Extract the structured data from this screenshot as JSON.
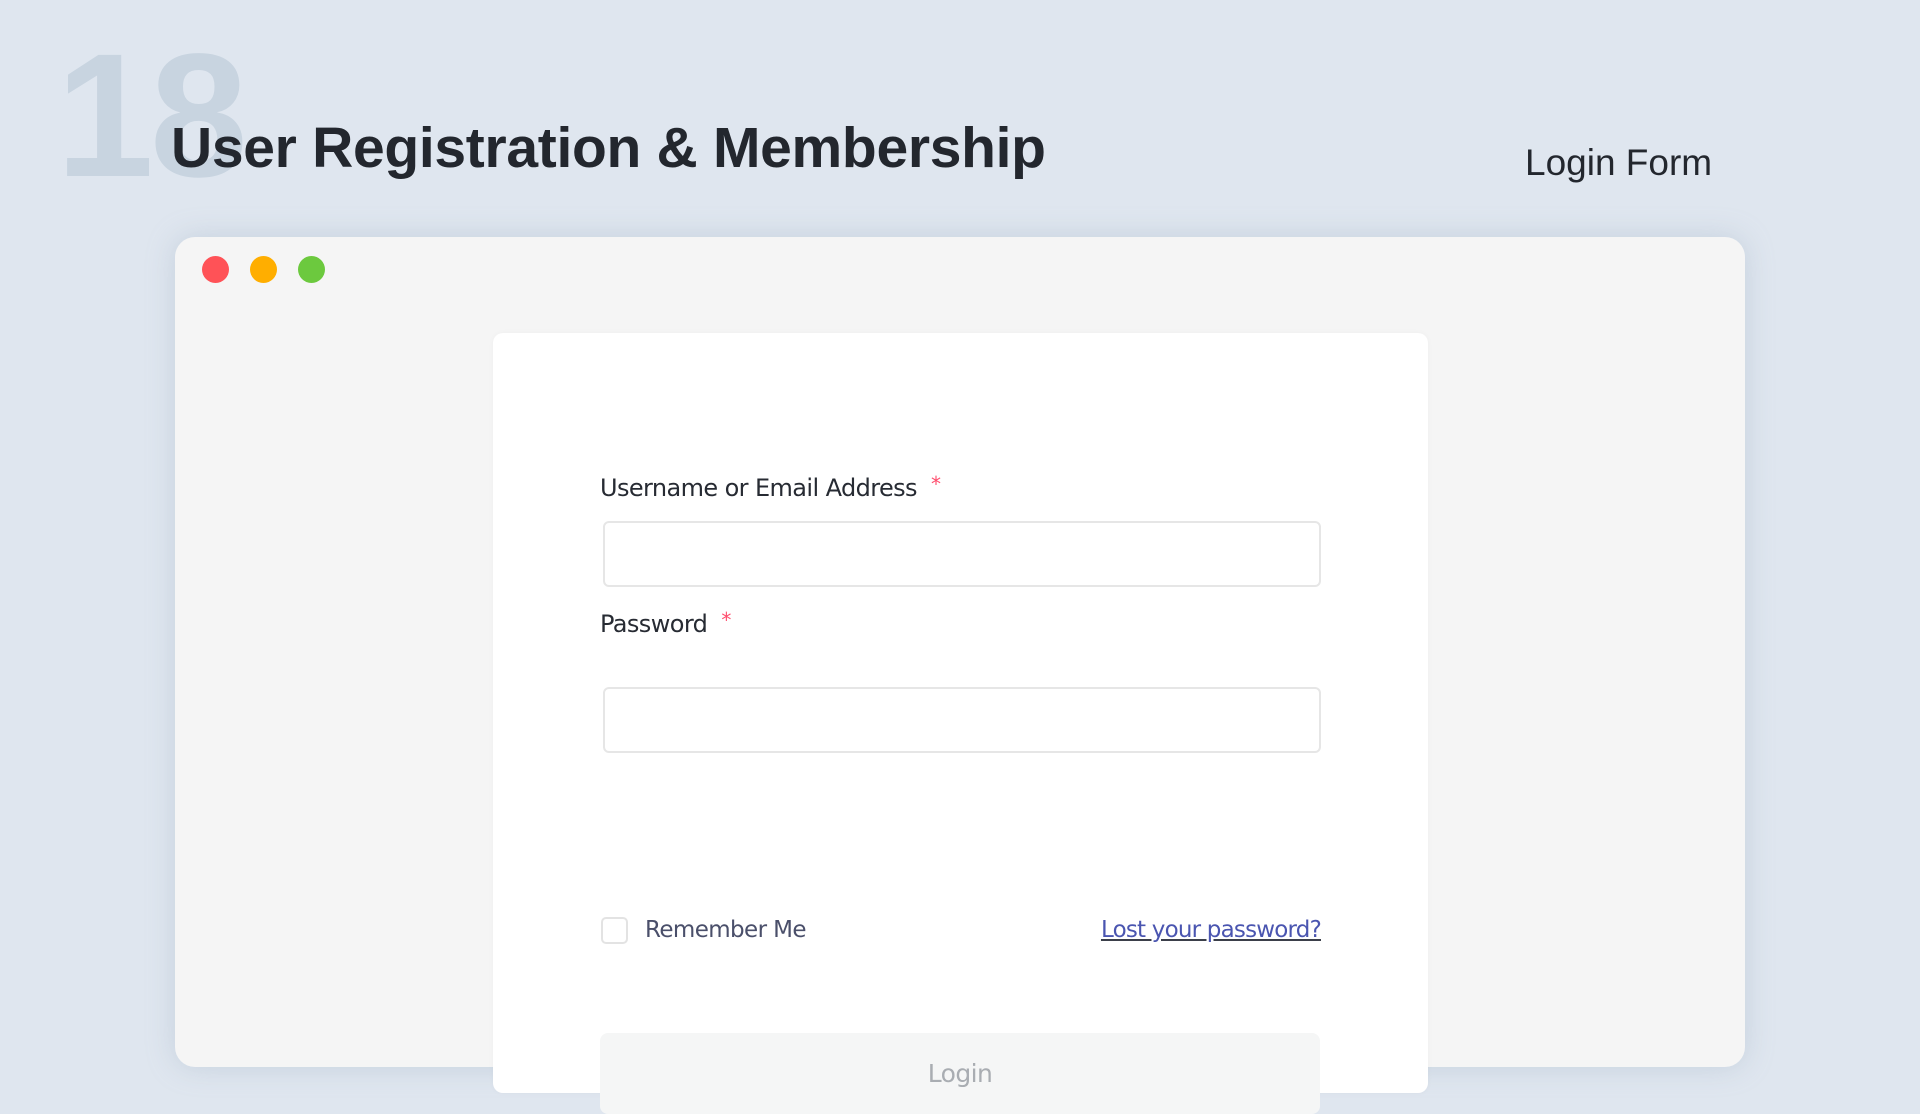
{
  "header": {
    "number": "18",
    "title": "User Registration & Membership",
    "subtitle": "Login Form"
  },
  "window": {
    "traffic_lights": [
      {
        "name": "close",
        "color": "#ff5257"
      },
      {
        "name": "minimize",
        "color": "#ffae00"
      },
      {
        "name": "maximize",
        "color": "#6cc93e"
      }
    ]
  },
  "form": {
    "username": {
      "label": "Username or Email Address",
      "required_marker": "*",
      "value": "",
      "placeholder": ""
    },
    "password": {
      "label": "Password",
      "required_marker": "*",
      "value": "",
      "placeholder": ""
    },
    "remember_me": {
      "label": "Remember Me",
      "checked": false
    },
    "lost_password_link": "Lost your password?",
    "login_button": "Login"
  },
  "colors": {
    "page_background": "#dfe6ef",
    "window_background": "#f5f5f5",
    "card_background": "#ffffff",
    "required_marker": "#ff4d6d",
    "link": "#4a55b0",
    "button_background": "#f5f6f6",
    "button_text": "#a9adb2"
  }
}
